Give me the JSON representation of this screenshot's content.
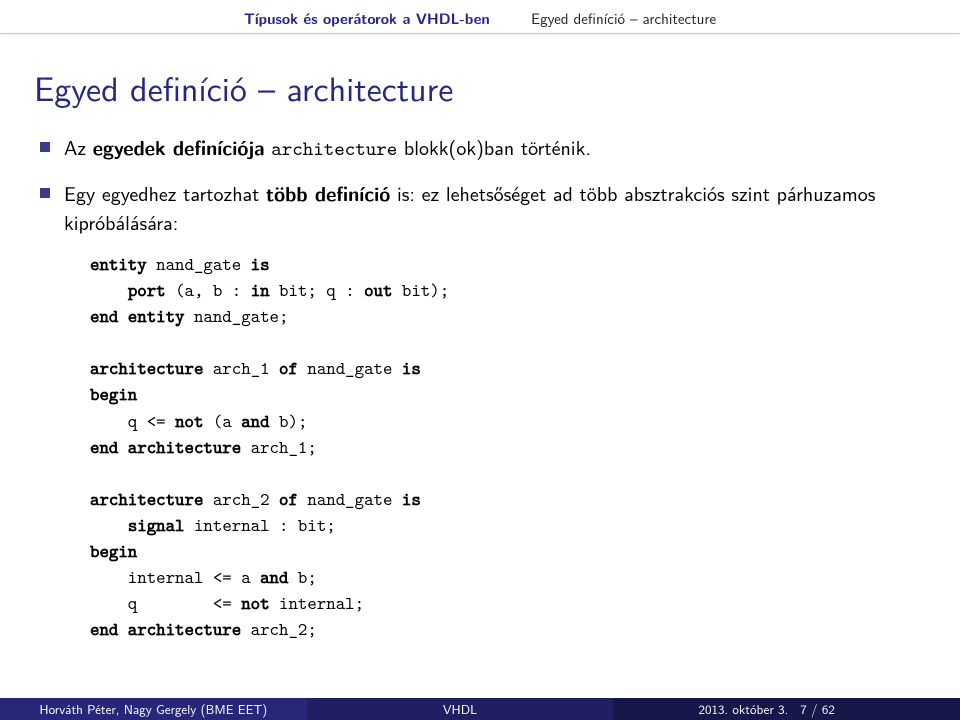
{
  "nav": {
    "section": "Típusok és operátorok a VHDL-ben",
    "subsection": "Egyed definíció – architecture"
  },
  "title": "Egyed definíció – architecture",
  "bullets": {
    "b1_pre": "Az ",
    "b1_bold": "egyedek definíciója",
    "b1_mid": " ",
    "b1_tt": "architecture",
    "b1_post": " blokk(ok)ban történik.",
    "b2_pre": "Egy egyedhez tartozhat ",
    "b2_bold": "több definíció",
    "b2_post": " is: ez lehetsőséget ad több absztrakciós szint párhuzamos kipróbálására:"
  },
  "code": {
    "l01a": "entity",
    "l01b": " nand_gate ",
    "l01c": "is",
    "l02a": "    ",
    "l02b": "port",
    "l02c": " (a, b : ",
    "l02d": "in",
    "l02e": " bit; q : ",
    "l02f": "out",
    "l02g": " bit);",
    "l03a": "end entity",
    "l03b": " nand_gate;",
    "l05a": "architecture",
    "l05b": " arch_1 ",
    "l05c": "of",
    "l05d": " nand_gate ",
    "l05e": "is",
    "l06a": "begin",
    "l07a": "    q <= ",
    "l07b": "not",
    "l07c": " (a ",
    "l07d": "and",
    "l07e": " b);",
    "l08a": "end architecture",
    "l08b": " arch_1;",
    "l10a": "architecture",
    "l10b": " arch_2 ",
    "l10c": "of",
    "l10d": " nand_gate ",
    "l10e": "is",
    "l11a": "    ",
    "l11b": "signal",
    "l11c": " internal : bit;",
    "l12a": "begin",
    "l13a": "    internal <= a ",
    "l13b": "and",
    "l13c": " b;",
    "l14a": "    q        <= ",
    "l14b": "not",
    "l14c": " internal;",
    "l15a": "end architecture",
    "l15b": " arch_2;"
  },
  "footer": {
    "author": "Horváth Péter, Nagy Gergely (BME EET)",
    "short_title": "VHDL",
    "date": "2013. október 3.",
    "page": "7 / 62"
  }
}
